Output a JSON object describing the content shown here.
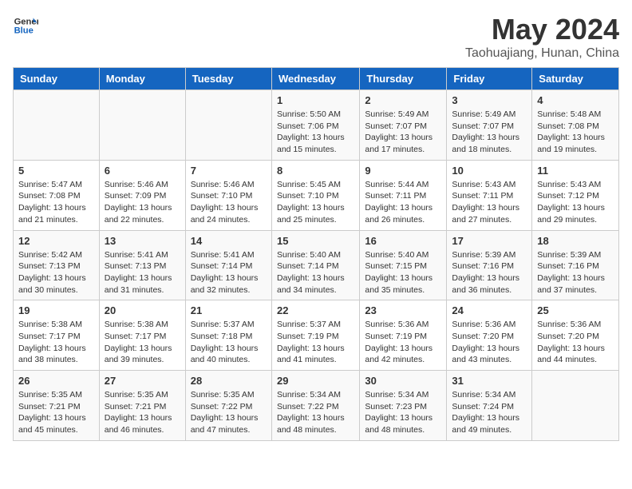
{
  "header": {
    "logo_line1": "General",
    "logo_line2": "Blue",
    "month": "May 2024",
    "location": "Taohuajiang, Hunan, China"
  },
  "days_of_week": [
    "Sunday",
    "Monday",
    "Tuesday",
    "Wednesday",
    "Thursday",
    "Friday",
    "Saturday"
  ],
  "weeks": [
    [
      {
        "day": "",
        "info": ""
      },
      {
        "day": "",
        "info": ""
      },
      {
        "day": "",
        "info": ""
      },
      {
        "day": "1",
        "info": "Sunrise: 5:50 AM\nSunset: 7:06 PM\nDaylight: 13 hours and 15 minutes."
      },
      {
        "day": "2",
        "info": "Sunrise: 5:49 AM\nSunset: 7:07 PM\nDaylight: 13 hours and 17 minutes."
      },
      {
        "day": "3",
        "info": "Sunrise: 5:49 AM\nSunset: 7:07 PM\nDaylight: 13 hours and 18 minutes."
      },
      {
        "day": "4",
        "info": "Sunrise: 5:48 AM\nSunset: 7:08 PM\nDaylight: 13 hours and 19 minutes."
      }
    ],
    [
      {
        "day": "5",
        "info": "Sunrise: 5:47 AM\nSunset: 7:08 PM\nDaylight: 13 hours and 21 minutes."
      },
      {
        "day": "6",
        "info": "Sunrise: 5:46 AM\nSunset: 7:09 PM\nDaylight: 13 hours and 22 minutes."
      },
      {
        "day": "7",
        "info": "Sunrise: 5:46 AM\nSunset: 7:10 PM\nDaylight: 13 hours and 24 minutes."
      },
      {
        "day": "8",
        "info": "Sunrise: 5:45 AM\nSunset: 7:10 PM\nDaylight: 13 hours and 25 minutes."
      },
      {
        "day": "9",
        "info": "Sunrise: 5:44 AM\nSunset: 7:11 PM\nDaylight: 13 hours and 26 minutes."
      },
      {
        "day": "10",
        "info": "Sunrise: 5:43 AM\nSunset: 7:11 PM\nDaylight: 13 hours and 27 minutes."
      },
      {
        "day": "11",
        "info": "Sunrise: 5:43 AM\nSunset: 7:12 PM\nDaylight: 13 hours and 29 minutes."
      }
    ],
    [
      {
        "day": "12",
        "info": "Sunrise: 5:42 AM\nSunset: 7:13 PM\nDaylight: 13 hours and 30 minutes."
      },
      {
        "day": "13",
        "info": "Sunrise: 5:41 AM\nSunset: 7:13 PM\nDaylight: 13 hours and 31 minutes."
      },
      {
        "day": "14",
        "info": "Sunrise: 5:41 AM\nSunset: 7:14 PM\nDaylight: 13 hours and 32 minutes."
      },
      {
        "day": "15",
        "info": "Sunrise: 5:40 AM\nSunset: 7:14 PM\nDaylight: 13 hours and 34 minutes."
      },
      {
        "day": "16",
        "info": "Sunrise: 5:40 AM\nSunset: 7:15 PM\nDaylight: 13 hours and 35 minutes."
      },
      {
        "day": "17",
        "info": "Sunrise: 5:39 AM\nSunset: 7:16 PM\nDaylight: 13 hours and 36 minutes."
      },
      {
        "day": "18",
        "info": "Sunrise: 5:39 AM\nSunset: 7:16 PM\nDaylight: 13 hours and 37 minutes."
      }
    ],
    [
      {
        "day": "19",
        "info": "Sunrise: 5:38 AM\nSunset: 7:17 PM\nDaylight: 13 hours and 38 minutes."
      },
      {
        "day": "20",
        "info": "Sunrise: 5:38 AM\nSunset: 7:17 PM\nDaylight: 13 hours and 39 minutes."
      },
      {
        "day": "21",
        "info": "Sunrise: 5:37 AM\nSunset: 7:18 PM\nDaylight: 13 hours and 40 minutes."
      },
      {
        "day": "22",
        "info": "Sunrise: 5:37 AM\nSunset: 7:19 PM\nDaylight: 13 hours and 41 minutes."
      },
      {
        "day": "23",
        "info": "Sunrise: 5:36 AM\nSunset: 7:19 PM\nDaylight: 13 hours and 42 minutes."
      },
      {
        "day": "24",
        "info": "Sunrise: 5:36 AM\nSunset: 7:20 PM\nDaylight: 13 hours and 43 minutes."
      },
      {
        "day": "25",
        "info": "Sunrise: 5:36 AM\nSunset: 7:20 PM\nDaylight: 13 hours and 44 minutes."
      }
    ],
    [
      {
        "day": "26",
        "info": "Sunrise: 5:35 AM\nSunset: 7:21 PM\nDaylight: 13 hours and 45 minutes."
      },
      {
        "day": "27",
        "info": "Sunrise: 5:35 AM\nSunset: 7:21 PM\nDaylight: 13 hours and 46 minutes."
      },
      {
        "day": "28",
        "info": "Sunrise: 5:35 AM\nSunset: 7:22 PM\nDaylight: 13 hours and 47 minutes."
      },
      {
        "day": "29",
        "info": "Sunrise: 5:34 AM\nSunset: 7:22 PM\nDaylight: 13 hours and 48 minutes."
      },
      {
        "day": "30",
        "info": "Sunrise: 5:34 AM\nSunset: 7:23 PM\nDaylight: 13 hours and 48 minutes."
      },
      {
        "day": "31",
        "info": "Sunrise: 5:34 AM\nSunset: 7:24 PM\nDaylight: 13 hours and 49 minutes."
      },
      {
        "day": "",
        "info": ""
      }
    ]
  ]
}
